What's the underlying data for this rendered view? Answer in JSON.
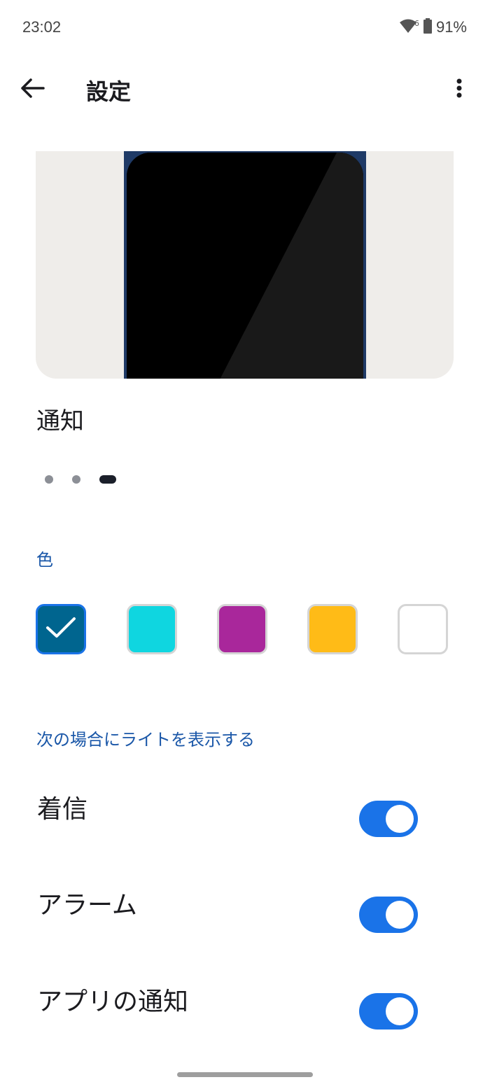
{
  "status_bar": {
    "time": "23:02",
    "battery": "91%",
    "network": "6"
  },
  "app_bar": {
    "title": "設定",
    "back_icon": "arrow-back-icon",
    "more_icon": "more-vert-icon"
  },
  "carousel": {
    "label": "通知",
    "page_count": 3,
    "active_page": 3
  },
  "color_section": {
    "header": "色",
    "swatches": [
      {
        "color": "#00658f",
        "selected": true
      },
      {
        "color": "#0fd6e0",
        "selected": false
      },
      {
        "color": "#a9279b",
        "selected": false
      },
      {
        "color": "#ffbb17",
        "selected": false
      },
      {
        "color": "#ffffff",
        "selected": false
      }
    ]
  },
  "light_section": {
    "header": "次の場合にライトを表示する",
    "toggles": [
      {
        "label": "着信",
        "on": true
      },
      {
        "label": "アラーム",
        "on": true
      },
      {
        "label": "アプリの通知",
        "on": true
      }
    ]
  },
  "colors": {
    "accent": "#1a73e8",
    "section_header": "#1a57a8"
  }
}
